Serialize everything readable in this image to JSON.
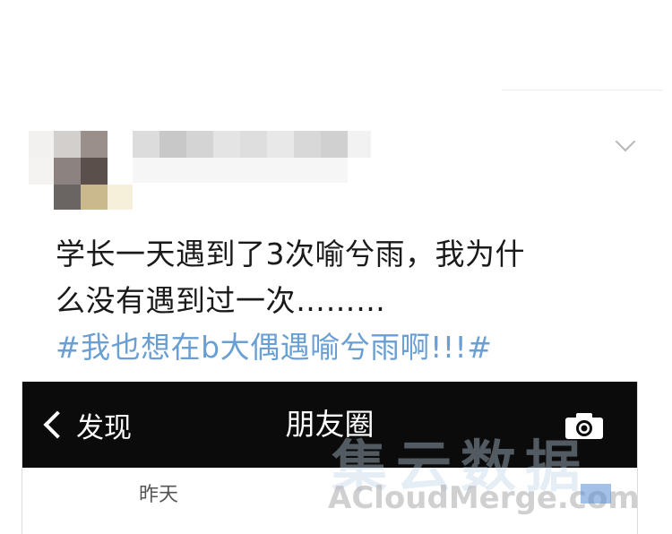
{
  "post": {
    "text_line1": "学长一天遇到了3次喻兮雨，我为什",
    "text_line2": "么没有遇到过一次………",
    "hashtag": "#我也想在b大偶遇喻兮雨啊!!!#"
  },
  "embedded_screenshot": {
    "back_label": "发现",
    "title": "朋友圈",
    "date_label": "昨天"
  },
  "watermark": {
    "text": "ACloudMerge.com",
    "cn_text": "集云数据"
  },
  "icons": {
    "more": "chevron-down-icon",
    "back": "chevron-left-icon",
    "camera": "camera-icon"
  },
  "colors": {
    "hashtag": "#6a9fd4",
    "navbar": "#0b0b0b"
  }
}
